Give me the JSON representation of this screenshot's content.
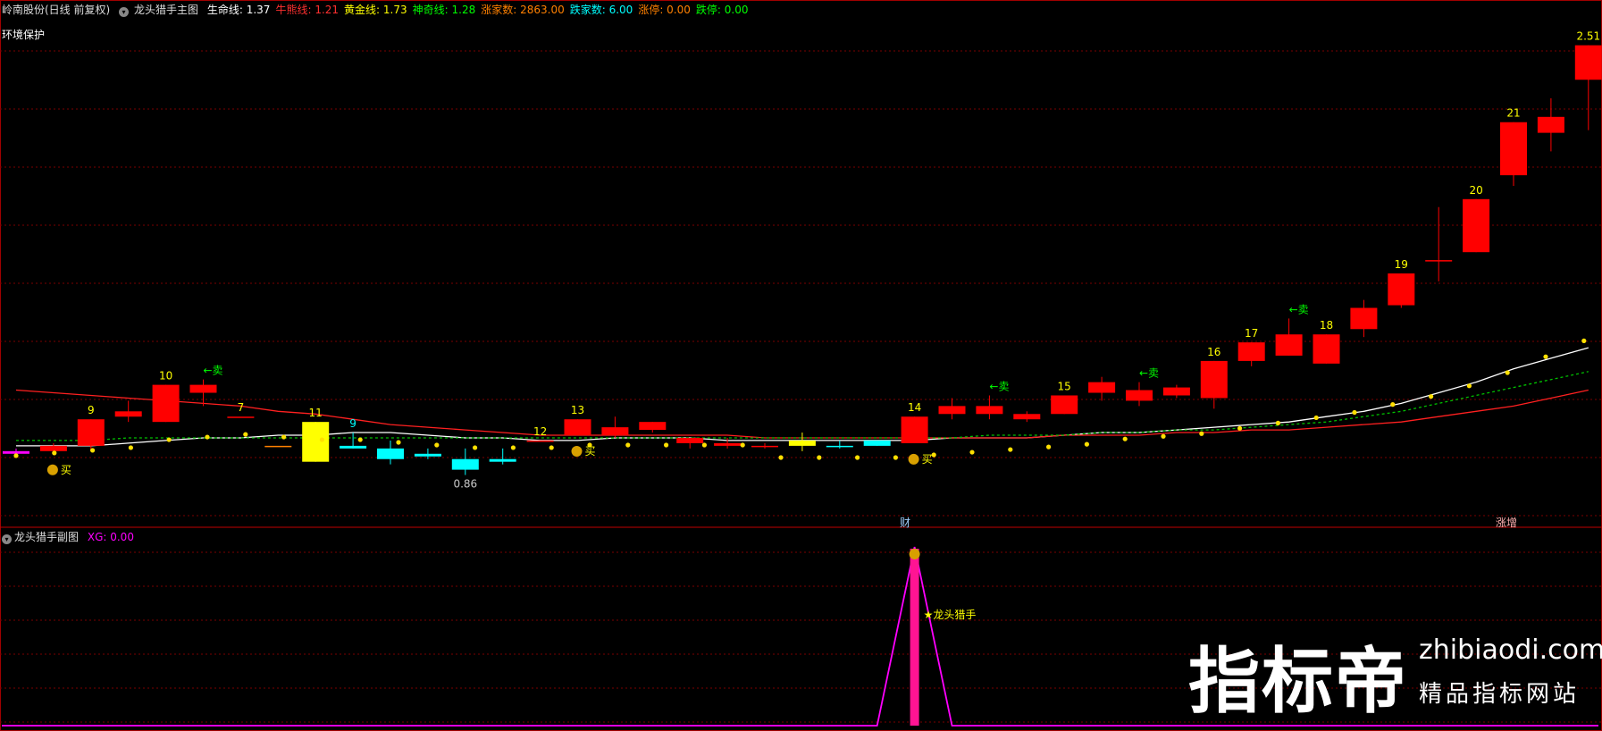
{
  "header": {
    "stock": "岭南股份(日线 前复权)",
    "indicator": "龙头猎手主图",
    "items": [
      {
        "label": "生命线:",
        "value": "1.37",
        "color": "#ffffff"
      },
      {
        "label": "牛熊线:",
        "value": "1.21",
        "color": "#ff3030"
      },
      {
        "label": "黄金线:",
        "value": "1.73",
        "color": "#ffff00"
      },
      {
        "label": "神奇线:",
        "value": "1.28",
        "color": "#00ff00"
      },
      {
        "label": "涨家数:",
        "value": "2863.00",
        "color": "#ff8000"
      },
      {
        "label": "跌家数:",
        "value": "6.00",
        "color": "#00ffff"
      },
      {
        "label": "涨停:",
        "value": "0.00",
        "color": "#ff8000"
      },
      {
        "label": "跌停:",
        "value": "0.00",
        "color": "#00ff00"
      }
    ],
    "status": "环境保护"
  },
  "sub_header": {
    "indicator": "龙头猎手副图",
    "xg_label": "XG:",
    "xg_value": "0.00"
  },
  "tags": {
    "cai": "财",
    "zhangzeng": "涨增"
  },
  "watermark": {
    "brand": "指标帝",
    "url": "zhibiaodi.com",
    "slogan": "精品指标网站"
  },
  "chart_data": [
    {
      "type": "candlestick",
      "title": "龙头猎手主图",
      "ylim": [
        0.72,
        2.62
      ],
      "candles": [
        {
          "o": 0.98,
          "h": 0.99,
          "l": 0.96,
          "c": 0.97,
          "color": "#ff00ff",
          "label": null
        },
        {
          "o": 1.0,
          "h": 1.01,
          "l": 0.97,
          "c": 0.98,
          "color": "#ff0000",
          "label": null
        },
        {
          "o": 1.0,
          "h": 1.1,
          "l": 0.98,
          "c": 1.1,
          "color": "#ff0000",
          "label": "9"
        },
        {
          "o": 1.11,
          "h": 1.17,
          "l": 1.09,
          "c": 1.13,
          "color": "#ff0000",
          "label": null
        },
        {
          "o": 1.09,
          "h": 1.23,
          "l": 1.09,
          "c": 1.23,
          "color": "#ff0000",
          "label": "10"
        },
        {
          "o": 1.2,
          "h": 1.25,
          "l": 1.15,
          "c": 1.23,
          "color": "#ff0000",
          "label": null
        },
        {
          "o": 1.11,
          "h": 1.11,
          "l": 1.11,
          "c": 1.11,
          "color": "#ff0000",
          "label": "7"
        },
        {
          "o": 1.0,
          "h": 1.0,
          "l": 1.0,
          "c": 1.0,
          "color": "#ff8000",
          "label": null
        },
        {
          "o": 1.09,
          "h": 1.09,
          "l": 0.94,
          "c": 0.94,
          "color": "#ffff00",
          "label": "11"
        },
        {
          "o": 1.0,
          "h": 1.05,
          "l": 0.99,
          "c": 0.99,
          "color": "#00ffff",
          "label": "9"
        },
        {
          "o": 0.99,
          "h": 1.02,
          "l": 0.93,
          "c": 0.95,
          "color": "#00ffff",
          "label": null
        },
        {
          "o": 0.97,
          "h": 0.99,
          "l": 0.95,
          "c": 0.96,
          "color": "#00ffff",
          "label": null
        },
        {
          "o": 0.95,
          "h": 0.99,
          "l": 0.89,
          "c": 0.91,
          "color": "#00ffff",
          "label": "0.86"
        },
        {
          "o": 0.95,
          "h": 0.99,
          "l": 0.93,
          "c": 0.94,
          "color": "#00ffff",
          "label": null
        },
        {
          "o": 1.02,
          "h": 1.02,
          "l": 1.02,
          "c": 1.02,
          "color": "#ff0000",
          "label": "12"
        },
        {
          "o": 1.04,
          "h": 1.1,
          "l": 1.04,
          "c": 1.1,
          "color": "#ff0000",
          "label": "13"
        },
        {
          "o": 1.04,
          "h": 1.11,
          "l": 1.03,
          "c": 1.07,
          "color": "#ff0000",
          "label": null
        },
        {
          "o": 1.06,
          "h": 1.09,
          "l": 1.05,
          "c": 1.09,
          "color": "#ff0000",
          "label": null
        },
        {
          "o": 1.01,
          "h": 1.03,
          "l": 0.99,
          "c": 1.03,
          "color": "#ff0000",
          "label": null
        },
        {
          "o": 1.01,
          "h": 1.03,
          "l": 0.99,
          "c": 1.0,
          "color": "#ff0000",
          "label": null
        },
        {
          "o": 1.0,
          "h": 1.01,
          "l": 0.99,
          "c": 1.0,
          "color": "#ff0000",
          "label": null
        },
        {
          "o": 1.0,
          "h": 1.05,
          "l": 0.98,
          "c": 1.02,
          "color": "#ffff00",
          "label": null
        },
        {
          "o": 1.0,
          "h": 1.02,
          "l": 0.99,
          "c": 1.0,
          "color": "#00ffff",
          "label": null
        },
        {
          "o": 1.02,
          "h": 1.02,
          "l": 1.0,
          "c": 1.0,
          "color": "#00ffff",
          "label": null
        },
        {
          "o": 1.01,
          "h": 1.11,
          "l": 1.01,
          "c": 1.11,
          "color": "#ff0000",
          "label": "14"
        },
        {
          "o": 1.12,
          "h": 1.18,
          "l": 1.1,
          "c": 1.15,
          "color": "#ff0000",
          "label": null
        },
        {
          "o": 1.12,
          "h": 1.19,
          "l": 1.1,
          "c": 1.15,
          "color": "#ff0000",
          "label": null
        },
        {
          "o": 1.1,
          "h": 1.13,
          "l": 1.09,
          "c": 1.12,
          "color": "#ff0000",
          "label": null
        },
        {
          "o": 1.12,
          "h": 1.19,
          "l": 1.12,
          "c": 1.19,
          "color": "#ff0000",
          "label": "15"
        },
        {
          "o": 1.2,
          "h": 1.26,
          "l": 1.17,
          "c": 1.24,
          "color": "#ff0000",
          "label": null
        },
        {
          "o": 1.17,
          "h": 1.24,
          "l": 1.15,
          "c": 1.21,
          "color": "#ff0000",
          "label": null
        },
        {
          "o": 1.19,
          "h": 1.23,
          "l": 1.18,
          "c": 1.22,
          "color": "#ff0000",
          "label": null
        },
        {
          "o": 1.18,
          "h": 1.32,
          "l": 1.14,
          "c": 1.32,
          "color": "#ff0000",
          "label": "16"
        },
        {
          "o": 1.32,
          "h": 1.39,
          "l": 1.3,
          "c": 1.39,
          "color": "#ff0000",
          "label": "17"
        },
        {
          "o": 1.34,
          "h": 1.48,
          "l": 1.34,
          "c": 1.42,
          "color": "#ff0000",
          "label": null
        },
        {
          "o": 1.31,
          "h": 1.42,
          "l": 1.31,
          "c": 1.42,
          "color": "#ff0000",
          "label": "18"
        },
        {
          "o": 1.44,
          "h": 1.55,
          "l": 1.41,
          "c": 1.52,
          "color": "#ff0000",
          "label": null
        },
        {
          "o": 1.53,
          "h": 1.65,
          "l": 1.52,
          "c": 1.65,
          "color": "#ff0000",
          "label": "19"
        },
        {
          "o": 1.7,
          "h": 1.9,
          "l": 1.62,
          "c": 1.7,
          "color": "#ff0000",
          "label": null
        },
        {
          "o": 1.73,
          "h": 1.93,
          "l": 1.73,
          "c": 1.93,
          "color": "#ff0000",
          "label": "20"
        },
        {
          "o": 2.02,
          "h": 2.22,
          "l": 1.98,
          "c": 2.22,
          "color": "#ff0000",
          "label": "21"
        },
        {
          "o": 2.18,
          "h": 2.31,
          "l": 2.11,
          "c": 2.24,
          "color": "#ff0000",
          "label": null
        },
        {
          "o": 2.38,
          "h": 2.51,
          "l": 2.19,
          "c": 2.51,
          "color": "#ff0000",
          "label": "2.51"
        }
      ],
      "lines": [
        {
          "name": "生命线",
          "color": "#ffffff",
          "style": "solid",
          "values": [
            1.0,
            1.0,
            1.0,
            1.01,
            1.02,
            1.03,
            1.03,
            1.04,
            1.04,
            1.05,
            1.05,
            1.04,
            1.03,
            1.03,
            1.02,
            1.02,
            1.03,
            1.03,
            1.03,
            1.02,
            1.02,
            1.02,
            1.02,
            1.02,
            1.02,
            1.03,
            1.03,
            1.03,
            1.04,
            1.05,
            1.05,
            1.06,
            1.07,
            1.08,
            1.09,
            1.11,
            1.13,
            1.16,
            1.2,
            1.24,
            1.29,
            1.33,
            1.37
          ]
        },
        {
          "name": "牛熊线",
          "color": "#ff2020",
          "style": "solid",
          "values": [
            1.21,
            1.2,
            1.19,
            1.18,
            1.17,
            1.16,
            1.15,
            1.13,
            1.12,
            1.1,
            1.08,
            1.07,
            1.06,
            1.05,
            1.04,
            1.04,
            1.04,
            1.04,
            1.04,
            1.04,
            1.03,
            1.03,
            1.03,
            1.03,
            1.03,
            1.03,
            1.03,
            1.03,
            1.04,
            1.04,
            1.04,
            1.05,
            1.05,
            1.06,
            1.06,
            1.07,
            1.08,
            1.09,
            1.11,
            1.13,
            1.15,
            1.18,
            1.21
          ]
        },
        {
          "name": "神奇线",
          "color": "#00c000",
          "style": "dashed",
          "values": [
            1.02,
            1.02,
            1.02,
            1.03,
            1.03,
            1.03,
            1.03,
            1.03,
            1.03,
            1.03,
            1.03,
            1.03,
            1.03,
            1.03,
            1.03,
            1.03,
            1.03,
            1.03,
            1.03,
            1.03,
            1.03,
            1.03,
            1.03,
            1.03,
            1.03,
            1.03,
            1.04,
            1.04,
            1.04,
            1.05,
            1.05,
            1.06,
            1.06,
            1.07,
            1.08,
            1.09,
            1.11,
            1.13,
            1.16,
            1.19,
            1.22,
            1.25,
            1.28
          ]
        }
      ],
      "dots": [
        0.99,
        1.0,
        1.01,
        1.02,
        1.05,
        1.06,
        1.07,
        1.06,
        1.05,
        1.05,
        1.04,
        1.03,
        1.02,
        1.02,
        1.02,
        1.03,
        1.03,
        1.03,
        1.03,
        1.03,
        1.03,
        1.03,
        1.03,
        1.03,
        1.04,
        1.05,
        1.06,
        1.07,
        1.08,
        1.1,
        1.11,
        1.12,
        1.14,
        1.16,
        1.18,
        1.2,
        1.23,
        1.26,
        1.3,
        1.35,
        1.41,
        1.47,
        1.54
      ],
      "signals": [
        {
          "index": 1,
          "text": "买",
          "type": "buy",
          "color": "#ffff00"
        },
        {
          "index": 15,
          "text": "买",
          "type": "buy",
          "color": "#ffff00"
        },
        {
          "index": 24,
          "text": "买",
          "type": "buy",
          "color": "#ffff00"
        },
        {
          "index": 5,
          "text": "←卖",
          "type": "sell",
          "color": "#00ff00"
        },
        {
          "index": 26,
          "text": "←卖",
          "type": "sell",
          "color": "#00ff00"
        },
        {
          "index": 30,
          "text": "←卖",
          "type": "sell",
          "color": "#00ff00"
        },
        {
          "index": 34,
          "text": "←卖",
          "type": "sell",
          "color": "#00ff00"
        }
      ]
    },
    {
      "type": "line",
      "title": "龙头猎手副图",
      "ylim": [
        0,
        1
      ],
      "series": [
        {
          "name": "XG",
          "color": "#ff00ff",
          "values": [
            0,
            0,
            0,
            0,
            0,
            0,
            0,
            0,
            0,
            0,
            0,
            0,
            0,
            0,
            0,
            0,
            0,
            0,
            0,
            0,
            0,
            0,
            0,
            0,
            1,
            0,
            0,
            0,
            0,
            0,
            0,
            0,
            0,
            0,
            0,
            0,
            0,
            0,
            0,
            0,
            0,
            0,
            0
          ]
        }
      ],
      "annotation": {
        "index": 24,
        "text": "龙头猎手",
        "color": "#ffff00"
      }
    }
  ]
}
